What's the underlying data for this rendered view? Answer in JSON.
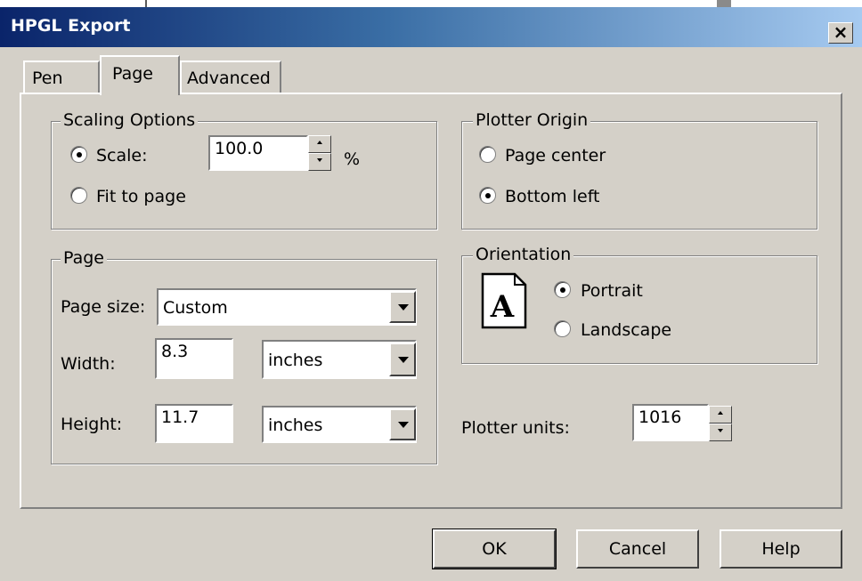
{
  "window": {
    "title": "HPGL Export",
    "close_glyph": "×"
  },
  "tabs": [
    {
      "label": "Pen"
    },
    {
      "label": "Page"
    },
    {
      "label": "Advanced"
    }
  ],
  "scaling": {
    "legend": "Scaling Options",
    "scale_label": "Scale:",
    "scale_value": "100.0",
    "scale_unit": "%",
    "fit_label": "Fit to page",
    "selected": "scale"
  },
  "plotter_origin": {
    "legend": "Plotter Origin",
    "page_center_label": "Page center",
    "bottom_left_label": "Bottom left",
    "selected": "bottom_left"
  },
  "page": {
    "legend": "Page",
    "size_label": "Page size:",
    "size_value": "Custom",
    "width_label": "Width:",
    "width_value": "8.3",
    "width_unit": "inches",
    "height_label": "Height:",
    "height_value": "11.7",
    "height_unit": "inches"
  },
  "orientation": {
    "legend": "Orientation",
    "icon_letter": "A",
    "portrait_label": "Portrait",
    "landscape_label": "Landscape",
    "selected": "portrait"
  },
  "plotter_units": {
    "label": "Plotter units:",
    "value": "1016"
  },
  "buttons": {
    "ok": "OK",
    "cancel": "Cancel",
    "help": "Help"
  },
  "colors": {
    "titlebar_start": "#0a246a",
    "titlebar_end": "#a6caf0",
    "face": "#d4d0c8"
  }
}
